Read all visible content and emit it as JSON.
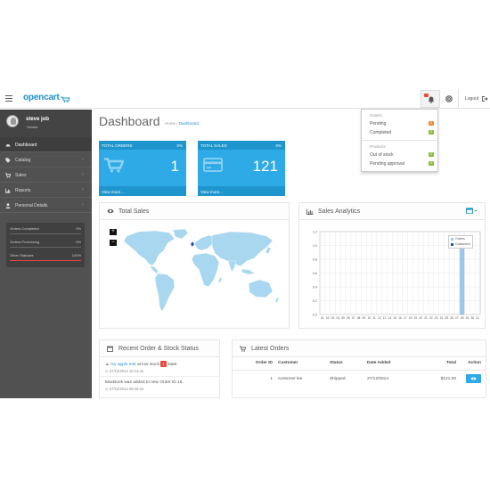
{
  "header": {
    "logo": "opencart",
    "logout_label": "Logout"
  },
  "sidebar": {
    "user_name": "steve job",
    "user_role": "Vendor",
    "items": [
      {
        "label": "Dashboard",
        "icon": "dashboard-icon"
      },
      {
        "label": "Catalog",
        "icon": "tag-icon"
      },
      {
        "label": "Sales",
        "icon": "cart-icon"
      },
      {
        "label": "Reports",
        "icon": "bar-chart-icon"
      },
      {
        "label": "Personal Details",
        "icon": "user-icon"
      }
    ],
    "stats": [
      {
        "label": "Orders Completed",
        "value": "0%",
        "fraction": 0
      },
      {
        "label": "Orders Processing",
        "value": "0%",
        "fraction": 0
      },
      {
        "label": "Other Statuses",
        "value": "100%",
        "fraction": 1
      }
    ]
  },
  "main": {
    "title": "Dashboard",
    "breadcrumb": {
      "home": "Home",
      "sep": "/",
      "current": "Dashboard"
    },
    "tiles": [
      {
        "title": "TOTAL ORDERS",
        "percent": "0%",
        "value": "1",
        "link": "View more..."
      },
      {
        "title": "TOTAL SALES",
        "percent": "0%",
        "value": "121",
        "link": "View more..."
      }
    ],
    "total_sales_panel": {
      "title": "Total Sales",
      "zoom_in": "+",
      "zoom_out": "−"
    },
    "analytics_panel": {
      "title": "Sales Analytics"
    },
    "recent_panel": {
      "title": "Recent Order & Stock Status",
      "items": [
        {
          "link": "my apple test",
          "text": "at low stock",
          "badge": "1",
          "suffix": "state.",
          "date": "27/12/2014 10:14:41"
        },
        {
          "text": "MacBook was added to new Order ID 15.",
          "date": "27/12/2014 06:26:24"
        }
      ]
    },
    "orders_panel": {
      "title": "Latest Orders",
      "columns": [
        "Order ID",
        "Customer",
        "Status",
        "Date Added",
        "Total",
        "Action"
      ],
      "rows": [
        {
          "order_id": "1",
          "customer": "customer lee",
          "status": "Shipped",
          "date_added": "27/12/2014",
          "total": "$121.00"
        }
      ]
    }
  },
  "notifications": {
    "orders_header": "Orders",
    "pending_label": "Pending",
    "pending_count": "0",
    "completed_label": "Completed",
    "completed_count": "0",
    "products_header": "Products",
    "out_of_stock_label": "Out of stock",
    "out_of_stock_count": "0",
    "pending_approval_label": "Pending approval",
    "pending_approval_count": "0"
  },
  "colors": {
    "accent": "#2eaae6",
    "sidebar": "#515151",
    "badge_orange": "#f38733",
    "badge_green": "#8fbb3c",
    "danger": "#e8483e"
  },
  "chart_data": {
    "type": "bar",
    "title": "Sales Analytics",
    "x": [
      "01",
      "02",
      "03",
      "04",
      "05",
      "06",
      "07",
      "08",
      "09",
      "10",
      "11",
      "12",
      "13",
      "14",
      "15",
      "16",
      "17",
      "18",
      "19",
      "20",
      "21",
      "22",
      "23",
      "24",
      "25",
      "26",
      "27",
      "28",
      "29",
      "30",
      "31"
    ],
    "series": [
      {
        "name": "Orders",
        "values": [
          0,
          0,
          0,
          0,
          0,
          0,
          0,
          0,
          0,
          0,
          0,
          0,
          0,
          0,
          0,
          0,
          0,
          0,
          0,
          0,
          0,
          0,
          0,
          0,
          0,
          0,
          0,
          1,
          0,
          0,
          0
        ]
      },
      {
        "name": "Customers",
        "values": [
          0,
          0,
          0,
          0,
          0,
          0,
          0,
          0,
          0,
          0,
          0,
          0,
          0,
          0,
          0,
          0,
          0,
          0,
          0,
          0,
          0,
          0,
          0,
          0,
          0,
          0,
          0,
          0,
          0,
          0,
          0
        ]
      }
    ],
    "yticks": [
      "0.0",
      "0.2",
      "0.4",
      "0.6",
      "0.8",
      "1.0",
      "1.2"
    ],
    "ylim": [
      0,
      1.2
    ],
    "grid": true,
    "legend": "top-right"
  }
}
